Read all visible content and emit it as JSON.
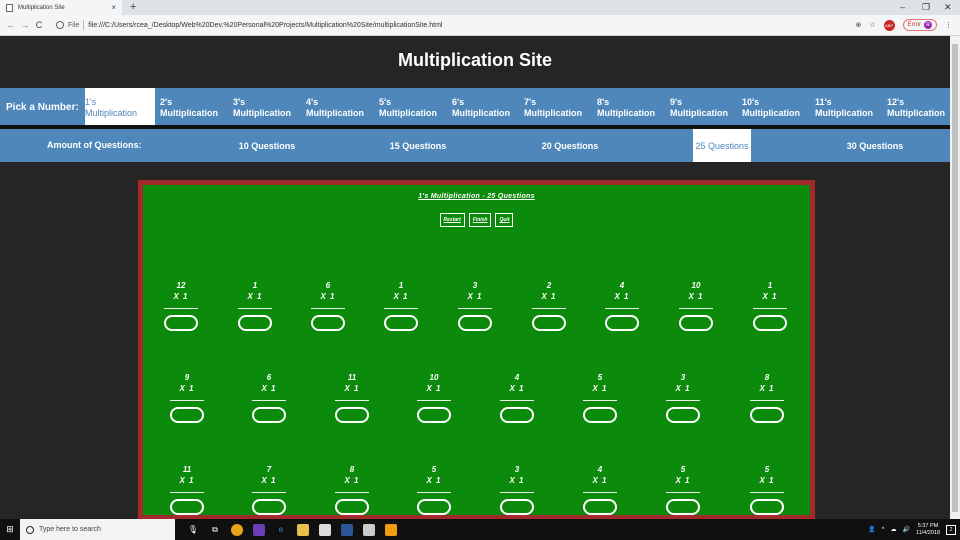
{
  "browser": {
    "tab_title": "Multiplication Site",
    "tab_close": "×",
    "new_tab": "+",
    "window_minimize": "–",
    "window_restore": "❐",
    "window_close": "✕",
    "back": "←",
    "forward": "→",
    "reload": "C",
    "scheme_label": "File",
    "url": "file:///C:/Users/rcea_/Desktop/Web%20Dev.%20Personal%20Projects/Multiplication%20Site/multiplicationSite.html",
    "zoom_icon": "⊕",
    "star_icon": "☆",
    "extension_badge": "ABP",
    "error_label": "Error",
    "avatar_letter": "R",
    "menu_icon": "⋮"
  },
  "site": {
    "title": "Multiplication Site",
    "pick_label": "Pick a Number:",
    "numbers": [
      {
        "line1": "1's",
        "line2": "Multiplication",
        "active": true
      },
      {
        "line1": "2's",
        "line2": "Multiplication"
      },
      {
        "line1": "3's",
        "line2": "Multiplication"
      },
      {
        "line1": "4's",
        "line2": "Multiplication"
      },
      {
        "line1": "5's",
        "line2": "Multiplication"
      },
      {
        "line1": "6's",
        "line2": "Multiplication"
      },
      {
        "line1": "7's",
        "line2": "Multiplication"
      },
      {
        "line1": "8's",
        "line2": "Multiplication"
      },
      {
        "line1": "9's",
        "line2": "Multiplication"
      },
      {
        "line1": "10's",
        "line2": "Multiplication"
      },
      {
        "line1": "11's",
        "line2": "Multiplication"
      },
      {
        "line1": "12's",
        "line2": "Multiplication"
      }
    ],
    "amount_label": "Amount of Questions:",
    "amounts": [
      "10 Questions",
      "15 Questions",
      "20 Questions",
      "25 Questions",
      "30 Questions"
    ],
    "active_amount": "25 Questions"
  },
  "board": {
    "title": "1's Multiplication - 25 Questions",
    "buttons": [
      "Restart",
      "Finish",
      "Quit"
    ],
    "multiplier_text": "X 1",
    "rows": [
      [
        "12",
        "1",
        "6",
        "1",
        "3",
        "2",
        "4",
        "10",
        "1"
      ],
      [
        "9",
        "6",
        "11",
        "10",
        "4",
        "5",
        "3",
        "8"
      ],
      [
        "11",
        "7",
        "8",
        "5",
        "3",
        "4",
        "5",
        "5"
      ]
    ]
  },
  "taskbar": {
    "start_icon": "⊞",
    "search_placeholder": "Type here to search",
    "time": "5:37 PM",
    "date": "11/4/2018",
    "notification_count": "2"
  },
  "colors": {
    "nav_blue": "#4f87bb",
    "board_green": "#0c8a0c",
    "board_border": "#a32a2a",
    "page_bg": "#252525"
  }
}
